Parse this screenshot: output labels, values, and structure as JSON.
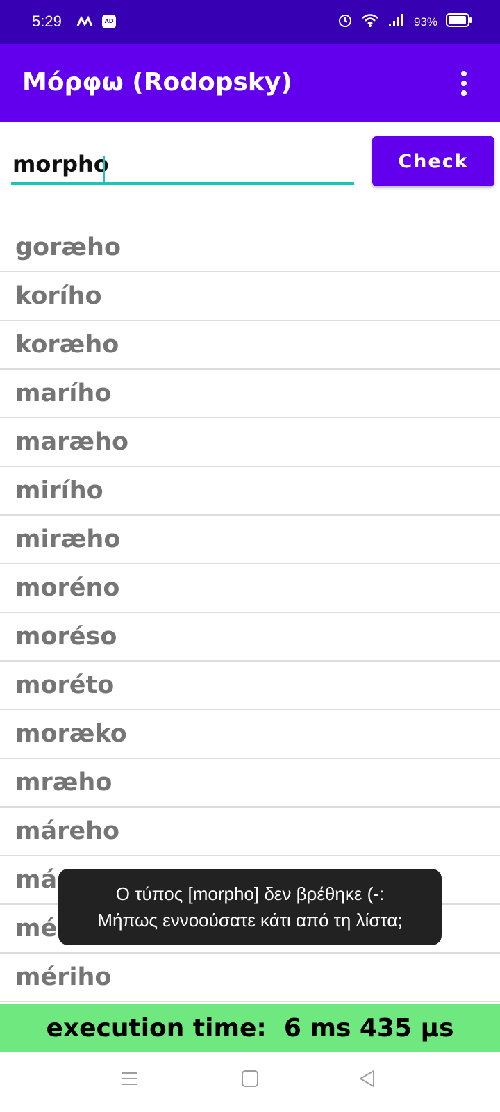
{
  "status_bar": {
    "time": "5:29",
    "battery": "93%",
    "icons": [
      "m-logo-icon",
      "ad-blocker-icon",
      "alarm-icon",
      "wifi-icon",
      "signal-icon",
      "battery-icon"
    ]
  },
  "app_bar": {
    "title": "Μόρφω (Rodopsky)",
    "menu_icon": "more-vert-icon"
  },
  "search": {
    "value": "morpho",
    "check_label": "Check"
  },
  "results": [
    "goræho",
    "korího",
    "koræho",
    "marího",
    "maræho",
    "mirího",
    "miræho",
    "moréno",
    "moréso",
    "moréto",
    "moræko",
    "mræho",
    "máreho",
    "máræho",
    "méræho",
    "mériho"
  ],
  "toast": {
    "line1": "Ο τύπος [morpho] δεν βρέθηκε (-:",
    "line2": "Μήπως εννοούσατε κάτι από τη λίστα;"
  },
  "execution": {
    "label": "execution time:  6 ms 435 μs"
  },
  "nav": {
    "icons": [
      "menu-icon",
      "home-icon",
      "back-icon"
    ]
  },
  "colors": {
    "status_bar": "#3700b3",
    "primary": "#6200ee",
    "accent": "#19c6b5",
    "exec_bar": "#6ee87f",
    "toast": "#222222"
  }
}
